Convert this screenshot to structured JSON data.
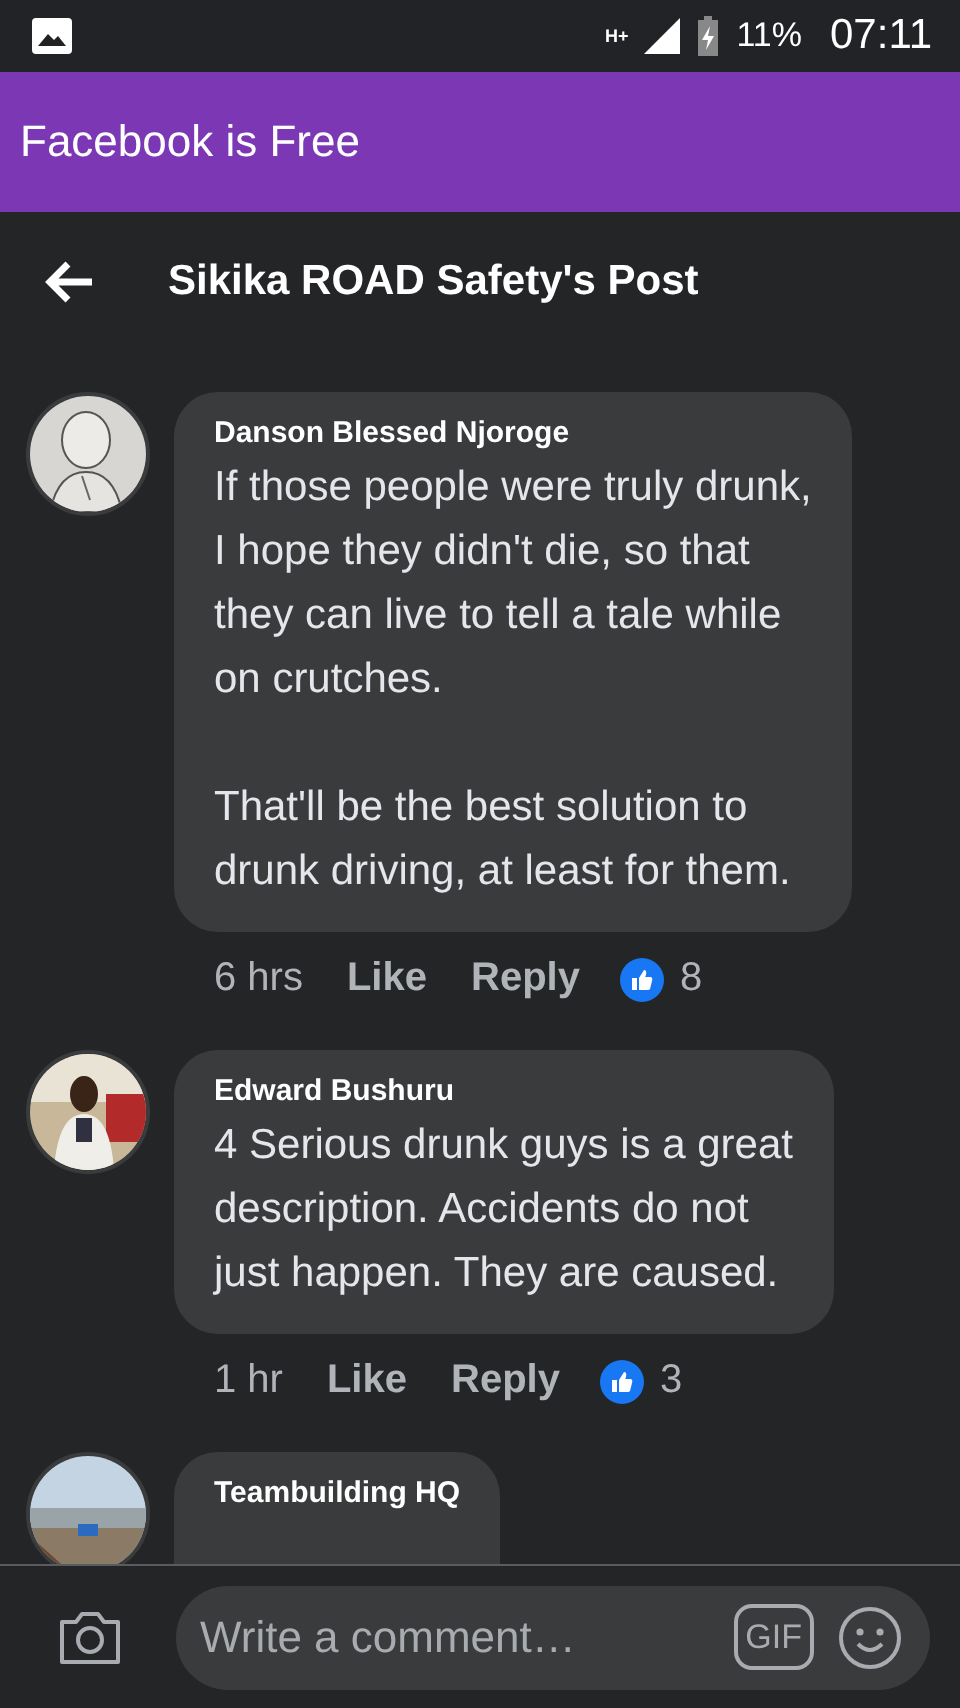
{
  "status_bar": {
    "network": "H+",
    "battery": "11%",
    "time": "07:11"
  },
  "app_banner": {
    "title": "Facebook is Free"
  },
  "header": {
    "title": "Sikika ROAD Safety's Post"
  },
  "comments": [
    {
      "author": "Danson Blessed Njoroge",
      "text": "If those people were truly drunk,\nI hope they didn't die, so that\nthey can live to tell a tale while\non crutches.\n\nThat'll be the best solution to\ndrunk driving, at least for them.",
      "time": "6 hrs",
      "like_label": "Like",
      "reply_label": "Reply",
      "reactions": "8"
    },
    {
      "author": "Edward Bushuru",
      "text": "4 Serious drunk guys is a great\ndescription. Accidents do not\njust happen. They are caused.",
      "time": "1 hr",
      "like_label": "Like",
      "reply_label": "Reply",
      "reactions": "3"
    },
    {
      "author": "Teambuilding HQ"
    }
  ],
  "composer": {
    "placeholder": "Write a comment…",
    "gif_label": "GIF"
  }
}
